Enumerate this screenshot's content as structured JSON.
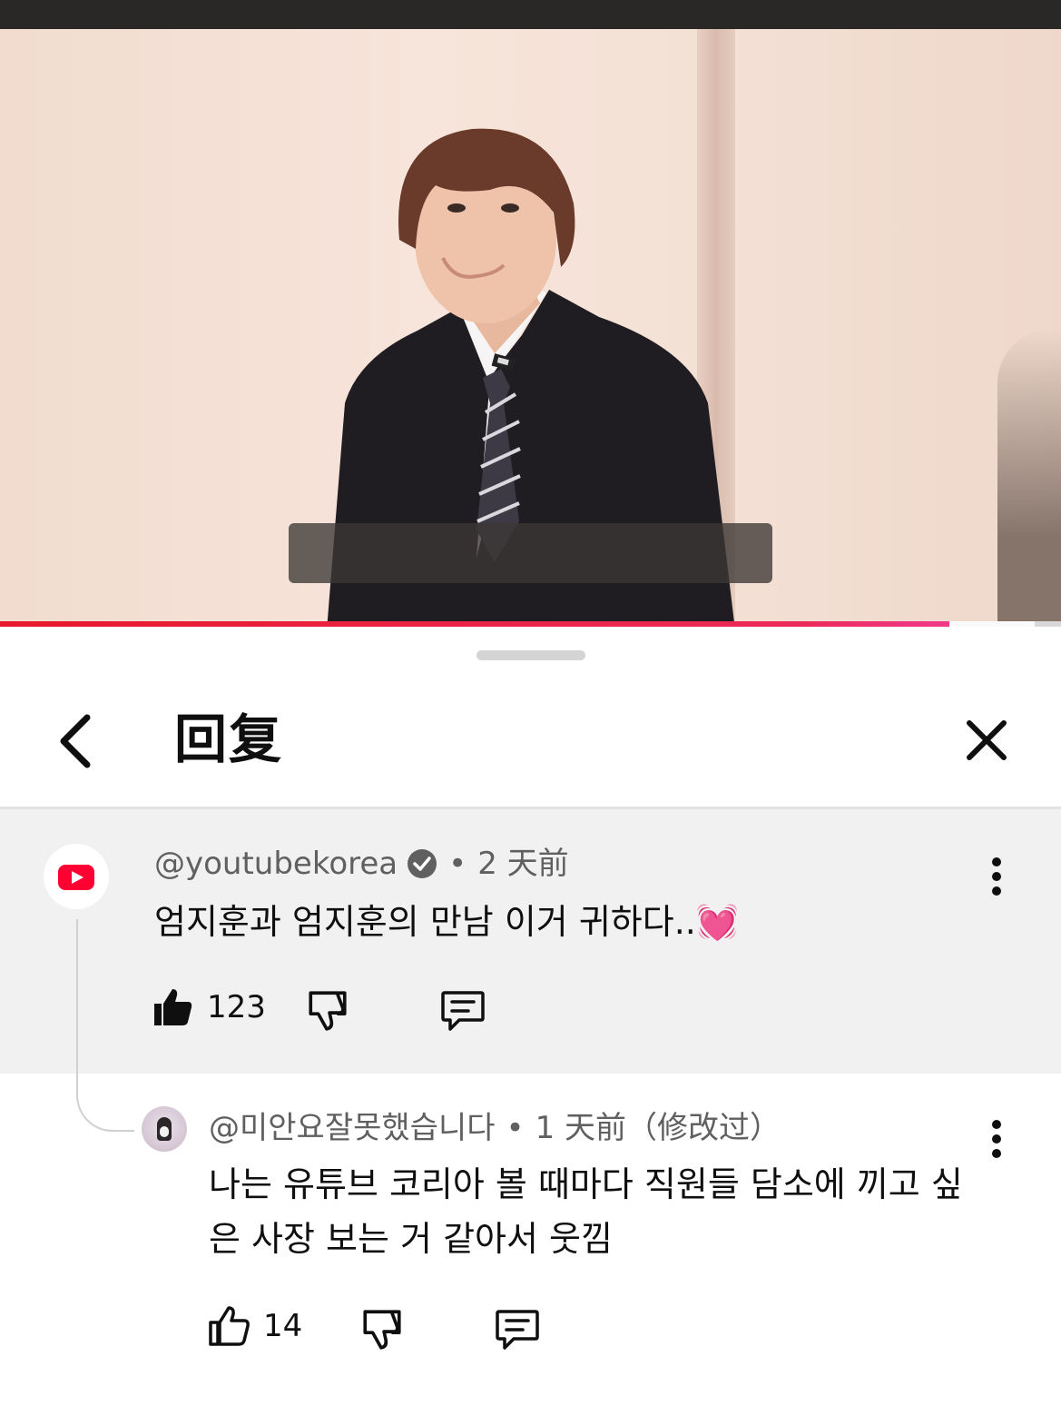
{
  "video": {
    "progress_fraction": 0.895,
    "buffer_end_fraction": 0.975
  },
  "header": {
    "title": "回复"
  },
  "parent_comment": {
    "author": "@youtubekorea",
    "verified": true,
    "separator": "•",
    "time": "2 天前",
    "text": "엄지훈과 엄지훈의 만남 이거 귀하다..",
    "emoji": "💓",
    "like_count": "123",
    "liked": true
  },
  "reply": {
    "author": "@미안요잘못했습니다",
    "separator": "•",
    "time": "1 天前",
    "edited": "（修改过）",
    "text_line1": "나는 유튜브 코리아 볼 때마다 직원들 담소에 끼고 싶",
    "text_line2": "은 사장 보는 거 같아서 웃낌",
    "like_count": "14",
    "liked": false
  },
  "icons": {
    "back": "chevron-left-icon",
    "close": "close-icon",
    "like": "thumbs-up-icon",
    "dislike": "thumbs-down-icon",
    "reply": "comment-icon",
    "more": "more-vertical-icon",
    "verified": "verified-check-icon"
  },
  "colors": {
    "accent_red": "#ff0033",
    "progress": "#e8192c",
    "muted_text": "#606060"
  }
}
